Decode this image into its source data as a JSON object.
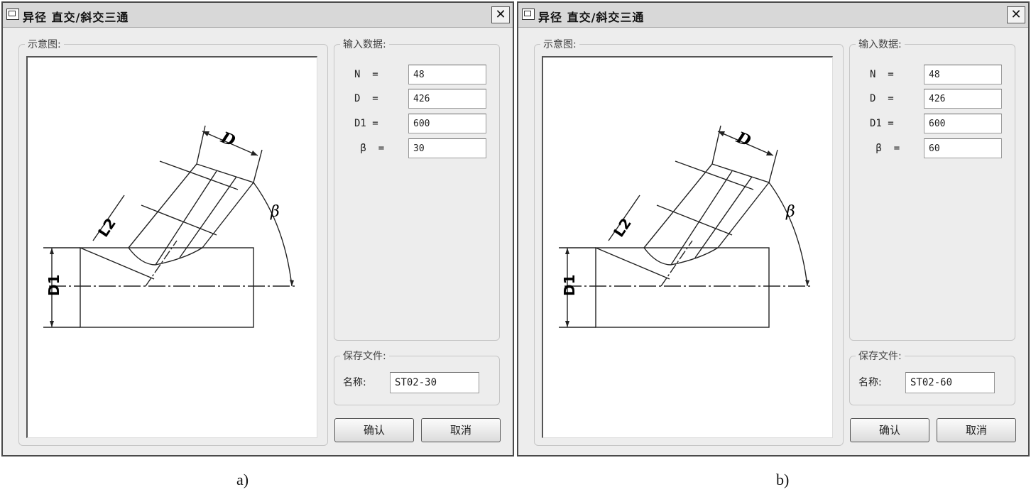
{
  "panels": [
    {
      "title": "异径 直交/斜交三通",
      "close_label": "✕",
      "diagram_group_label": "示意图:",
      "diagram": {
        "dim_D": "D",
        "dim_L2": "L2",
        "dim_D1": "D1",
        "dim_beta": "β"
      },
      "input_group_label": "输入数据:",
      "fields": [
        {
          "label": "N  =",
          "value": "48"
        },
        {
          "label": "D  =",
          "value": "426"
        },
        {
          "label": "D1 =",
          "value": "600"
        },
        {
          "label": " β  =",
          "value": "30"
        }
      ],
      "save_group_label": "保存文件:",
      "name_label": "名称:",
      "file_name": "ST02-30",
      "ok_label": "确认",
      "cancel_label": "取消",
      "caption": "a)"
    },
    {
      "title": "异径 直交/斜交三通",
      "close_label": "✕",
      "diagram_group_label": "示意图:",
      "diagram": {
        "dim_D": "D",
        "dim_L2": "L2",
        "dim_D1": "D1",
        "dim_beta": "β"
      },
      "input_group_label": "输入数据:",
      "fields": [
        {
          "label": "N  =",
          "value": "48"
        },
        {
          "label": "D  =",
          "value": "426"
        },
        {
          "label": "D1 =",
          "value": "600"
        },
        {
          "label": " β  =",
          "value": "60"
        }
      ],
      "save_group_label": "保存文件:",
      "name_label": "名称:",
      "file_name": "ST02-60",
      "ok_label": "确认",
      "cancel_label": "取消",
      "caption": "b)"
    }
  ]
}
